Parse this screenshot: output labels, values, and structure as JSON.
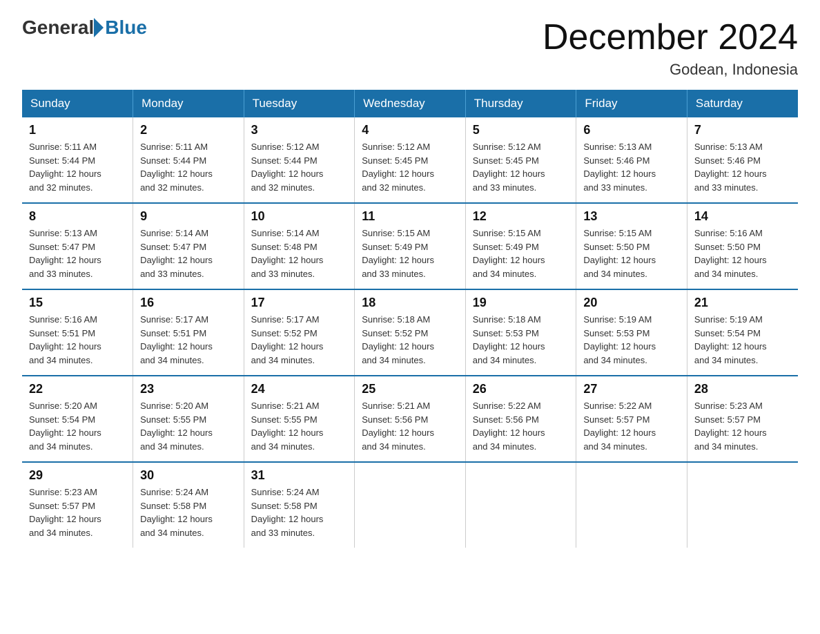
{
  "logo": {
    "general": "General",
    "blue": "Blue"
  },
  "title": "December 2024",
  "location": "Godean, Indonesia",
  "days_of_week": [
    "Sunday",
    "Monday",
    "Tuesday",
    "Wednesday",
    "Thursday",
    "Friday",
    "Saturday"
  ],
  "weeks": [
    [
      {
        "day": "1",
        "sunrise": "5:11 AM",
        "sunset": "5:44 PM",
        "daylight": "12 hours and 32 minutes."
      },
      {
        "day": "2",
        "sunrise": "5:11 AM",
        "sunset": "5:44 PM",
        "daylight": "12 hours and 32 minutes."
      },
      {
        "day": "3",
        "sunrise": "5:12 AM",
        "sunset": "5:44 PM",
        "daylight": "12 hours and 32 minutes."
      },
      {
        "day": "4",
        "sunrise": "5:12 AM",
        "sunset": "5:45 PM",
        "daylight": "12 hours and 32 minutes."
      },
      {
        "day": "5",
        "sunrise": "5:12 AM",
        "sunset": "5:45 PM",
        "daylight": "12 hours and 33 minutes."
      },
      {
        "day": "6",
        "sunrise": "5:13 AM",
        "sunset": "5:46 PM",
        "daylight": "12 hours and 33 minutes."
      },
      {
        "day": "7",
        "sunrise": "5:13 AM",
        "sunset": "5:46 PM",
        "daylight": "12 hours and 33 minutes."
      }
    ],
    [
      {
        "day": "8",
        "sunrise": "5:13 AM",
        "sunset": "5:47 PM",
        "daylight": "12 hours and 33 minutes."
      },
      {
        "day": "9",
        "sunrise": "5:14 AM",
        "sunset": "5:47 PM",
        "daylight": "12 hours and 33 minutes."
      },
      {
        "day": "10",
        "sunrise": "5:14 AM",
        "sunset": "5:48 PM",
        "daylight": "12 hours and 33 minutes."
      },
      {
        "day": "11",
        "sunrise": "5:15 AM",
        "sunset": "5:49 PM",
        "daylight": "12 hours and 33 minutes."
      },
      {
        "day": "12",
        "sunrise": "5:15 AM",
        "sunset": "5:49 PM",
        "daylight": "12 hours and 34 minutes."
      },
      {
        "day": "13",
        "sunrise": "5:15 AM",
        "sunset": "5:50 PM",
        "daylight": "12 hours and 34 minutes."
      },
      {
        "day": "14",
        "sunrise": "5:16 AM",
        "sunset": "5:50 PM",
        "daylight": "12 hours and 34 minutes."
      }
    ],
    [
      {
        "day": "15",
        "sunrise": "5:16 AM",
        "sunset": "5:51 PM",
        "daylight": "12 hours and 34 minutes."
      },
      {
        "day": "16",
        "sunrise": "5:17 AM",
        "sunset": "5:51 PM",
        "daylight": "12 hours and 34 minutes."
      },
      {
        "day": "17",
        "sunrise": "5:17 AM",
        "sunset": "5:52 PM",
        "daylight": "12 hours and 34 minutes."
      },
      {
        "day": "18",
        "sunrise": "5:18 AM",
        "sunset": "5:52 PM",
        "daylight": "12 hours and 34 minutes."
      },
      {
        "day": "19",
        "sunrise": "5:18 AM",
        "sunset": "5:53 PM",
        "daylight": "12 hours and 34 minutes."
      },
      {
        "day": "20",
        "sunrise": "5:19 AM",
        "sunset": "5:53 PM",
        "daylight": "12 hours and 34 minutes."
      },
      {
        "day": "21",
        "sunrise": "5:19 AM",
        "sunset": "5:54 PM",
        "daylight": "12 hours and 34 minutes."
      }
    ],
    [
      {
        "day": "22",
        "sunrise": "5:20 AM",
        "sunset": "5:54 PM",
        "daylight": "12 hours and 34 minutes."
      },
      {
        "day": "23",
        "sunrise": "5:20 AM",
        "sunset": "5:55 PM",
        "daylight": "12 hours and 34 minutes."
      },
      {
        "day": "24",
        "sunrise": "5:21 AM",
        "sunset": "5:55 PM",
        "daylight": "12 hours and 34 minutes."
      },
      {
        "day": "25",
        "sunrise": "5:21 AM",
        "sunset": "5:56 PM",
        "daylight": "12 hours and 34 minutes."
      },
      {
        "day": "26",
        "sunrise": "5:22 AM",
        "sunset": "5:56 PM",
        "daylight": "12 hours and 34 minutes."
      },
      {
        "day": "27",
        "sunrise": "5:22 AM",
        "sunset": "5:57 PM",
        "daylight": "12 hours and 34 minutes."
      },
      {
        "day": "28",
        "sunrise": "5:23 AM",
        "sunset": "5:57 PM",
        "daylight": "12 hours and 34 minutes."
      }
    ],
    [
      {
        "day": "29",
        "sunrise": "5:23 AM",
        "sunset": "5:57 PM",
        "daylight": "12 hours and 34 minutes."
      },
      {
        "day": "30",
        "sunrise": "5:24 AM",
        "sunset": "5:58 PM",
        "daylight": "12 hours and 34 minutes."
      },
      {
        "day": "31",
        "sunrise": "5:24 AM",
        "sunset": "5:58 PM",
        "daylight": "12 hours and 33 minutes."
      },
      null,
      null,
      null,
      null
    ]
  ],
  "labels": {
    "sunrise": "Sunrise:",
    "sunset": "Sunset:",
    "daylight": "Daylight:"
  }
}
